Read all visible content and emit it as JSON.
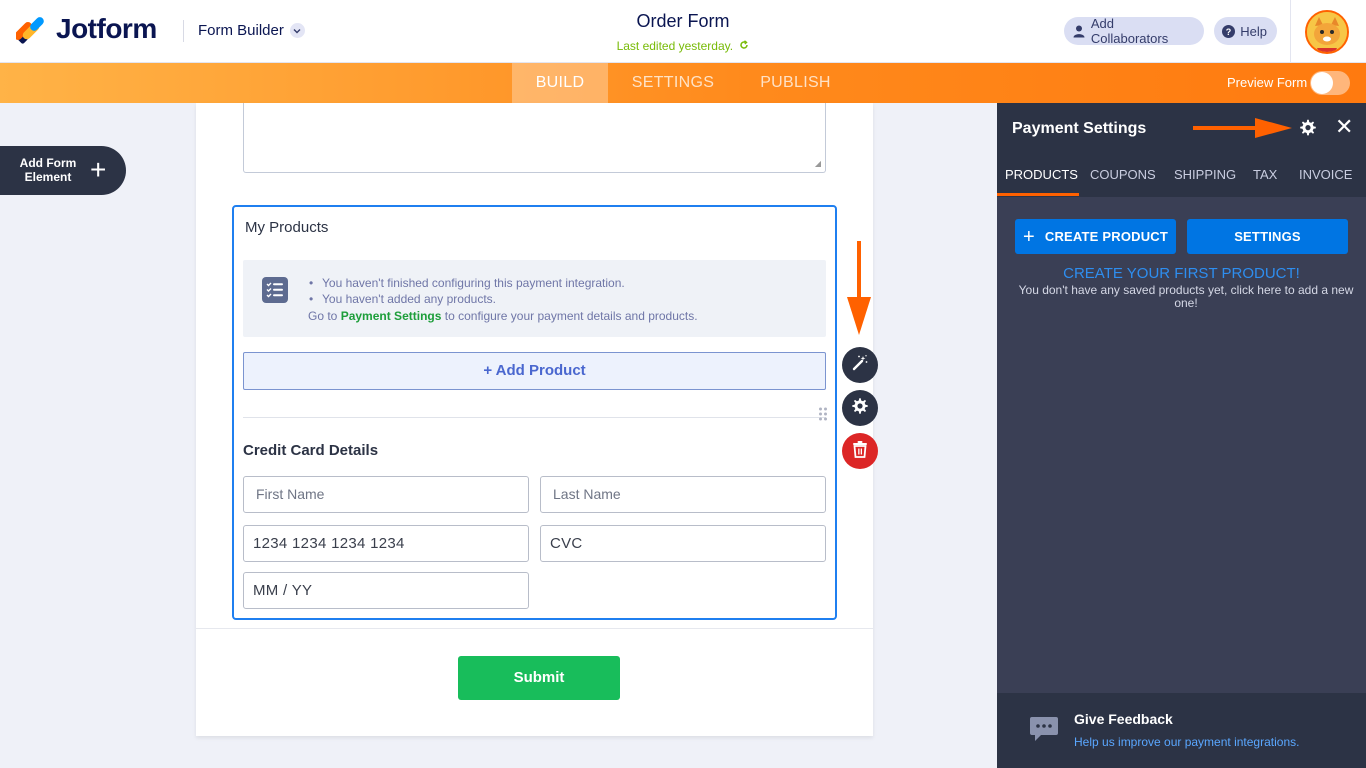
{
  "header": {
    "brand": "Jotform",
    "builder_label": "Form Builder",
    "form_title": "Order Form",
    "last_edited": "Last edited yesterday.",
    "add_collaborators": "Add Collaborators",
    "help": "Help"
  },
  "nav": {
    "tabs": [
      {
        "label": "BUILD",
        "active": true
      },
      {
        "label": "SETTINGS",
        "active": false
      },
      {
        "label": "PUBLISH",
        "active": false
      }
    ],
    "preview_label": "Preview Form",
    "preview_on": false
  },
  "sidebar": {
    "add_element_label": "Add Form Element"
  },
  "form": {
    "products_title": "My Products",
    "info_items": [
      "You haven't finished configuring this payment integration.",
      "You haven't added any products."
    ],
    "info_go_prefix": "Go to",
    "info_go_link": "Payment Settings",
    "info_go_suffix": "to configure your payment details and products.",
    "add_product": "+ Add Product",
    "cc_title": "Credit Card Details",
    "fields": {
      "first_name": "First Name",
      "last_name": "Last Name",
      "card_number": "1234 1234 1234 1234",
      "cvc": "CVC",
      "expiry": "MM / YY"
    },
    "submit": "Submit"
  },
  "panel": {
    "title": "Payment Settings",
    "tabs": [
      {
        "label": "PRODUCTS",
        "active": true
      },
      {
        "label": "COUPONS",
        "active": false
      },
      {
        "label": "SHIPPING",
        "active": false
      },
      {
        "label": "TAX",
        "active": false
      },
      {
        "label": "INVOICE",
        "active": false
      }
    ],
    "create_product": "CREATE PRODUCT",
    "settings": "SETTINGS",
    "first_product": "CREATE YOUR FIRST PRODUCT!",
    "first_product_sub": "You don't have any saved products yet, click here to add a new one!",
    "feedback_title": "Give Feedback",
    "feedback_link": "Help us improve our payment integrations."
  },
  "colors": {
    "brand_orange": "#ff6100",
    "accent_blue": "#0075e3",
    "submit_green": "#18bd5b",
    "panel_bg": "#3a3f55",
    "delete_red": "#dc2626"
  },
  "icons": [
    "jotform-logo",
    "chevron-down-icon",
    "refresh-icon",
    "user-icon",
    "help-icon",
    "plus-icon",
    "checklist-icon",
    "drag-handle-icon",
    "magic-wand-icon",
    "gear-icon",
    "trash-icon",
    "close-icon",
    "chat-bubble-icon",
    "arrow-icon"
  ]
}
